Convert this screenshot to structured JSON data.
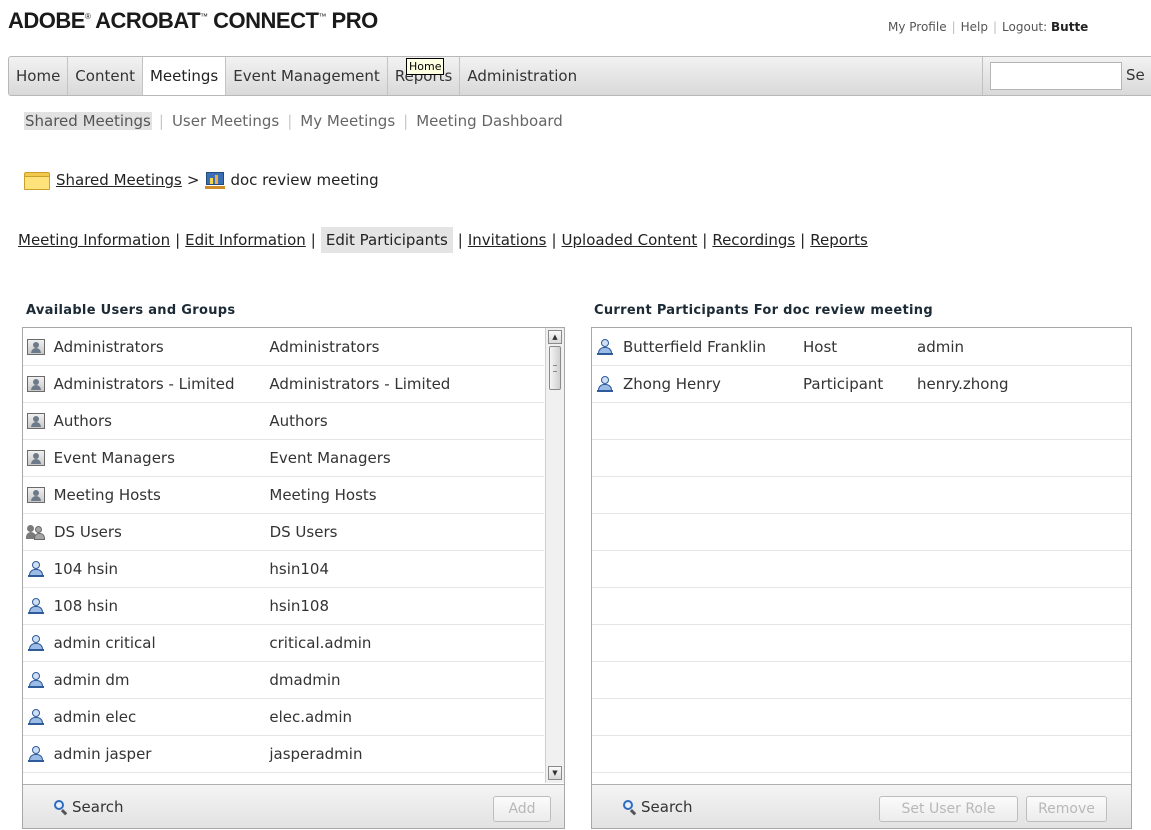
{
  "header": {
    "logo": {
      "part1": "ADOBE",
      "part2": " ACROBAT",
      "part3": " CONNECT",
      "part4": " PRO",
      "tm": "®",
      "tm2": "™"
    },
    "links": {
      "profile": "My Profile",
      "help": "Help",
      "logout_label": "Logout:",
      "user": "Butte"
    }
  },
  "nav": {
    "items": [
      "Home",
      "Content",
      "Meetings",
      "Event Management",
      "Reports",
      "Administration"
    ],
    "selected": "Meetings",
    "search_button": "Se",
    "search_value": ""
  },
  "tooltip": "Home",
  "subnav": {
    "items": [
      "Shared Meetings",
      "User Meetings",
      "My Meetings",
      "Meeting Dashboard"
    ],
    "selected": "Shared Meetings"
  },
  "breadcrumb": {
    "folder": "Shared Meetings",
    "separator": ">",
    "current": "doc review meeting"
  },
  "tabs": {
    "items": [
      "Meeting Information",
      "Edit Information",
      "Edit Participants",
      "Invitations",
      "Uploaded Content",
      "Recordings",
      "Reports"
    ],
    "selected": "Edit Participants"
  },
  "left_panel": {
    "title": "Available Users and Groups",
    "rows": [
      {
        "icon": "group-icon",
        "name": "Administrators",
        "login": "Administrators"
      },
      {
        "icon": "group-icon",
        "name": "Administrators - Limited",
        "login": "Administrators - Limited"
      },
      {
        "icon": "group-icon",
        "name": "Authors",
        "login": "Authors"
      },
      {
        "icon": "group-icon",
        "name": "Event Managers",
        "login": "Event Managers"
      },
      {
        "icon": "group-icon",
        "name": "Meeting Hosts",
        "login": "Meeting Hosts"
      },
      {
        "icon": "ds-users-icon",
        "name": "DS Users",
        "login": "DS Users"
      },
      {
        "icon": "user-icon",
        "name": "104 hsin",
        "login": "hsin104"
      },
      {
        "icon": "user-icon",
        "name": "108 hsin",
        "login": "hsin108"
      },
      {
        "icon": "user-icon",
        "name": "admin critical",
        "login": "critical.admin"
      },
      {
        "icon": "user-icon",
        "name": "admin dm",
        "login": "dmadmin"
      },
      {
        "icon": "user-icon",
        "name": "admin elec",
        "login": "elec.admin"
      },
      {
        "icon": "user-icon",
        "name": "admin jasper",
        "login": "jasperadmin"
      },
      {
        "icon": "user-icon",
        "name": "",
        "login": ""
      }
    ],
    "search_label": "Search",
    "add_label": "Add"
  },
  "right_panel": {
    "title": "Current Participants For doc review meeting",
    "rows": [
      {
        "name": "Butterfield Franklin",
        "role": "Host",
        "login": "admin"
      },
      {
        "name": "Zhong Henry",
        "role": "Participant",
        "login": "henry.zhong"
      }
    ],
    "empty_rows": 10,
    "search_label": "Search",
    "set_role_label": "Set User Role",
    "remove_label": "Remove"
  }
}
